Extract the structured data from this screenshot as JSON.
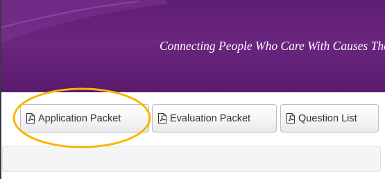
{
  "banner": {
    "tagline": "Connecting People Who Care With Causes That Matter.",
    "background_color": "#5e1d72"
  },
  "toolbar": {
    "buttons": [
      {
        "label": "Application Packet",
        "icon": "pdf-file-icon"
      },
      {
        "label": "Evaluation Packet",
        "icon": "pdf-file-icon"
      },
      {
        "label": "Question List",
        "icon": "pdf-file-icon"
      }
    ]
  },
  "annotation": {
    "highlight_color": "#f5b800",
    "highlighted_button": "Application Packet"
  }
}
